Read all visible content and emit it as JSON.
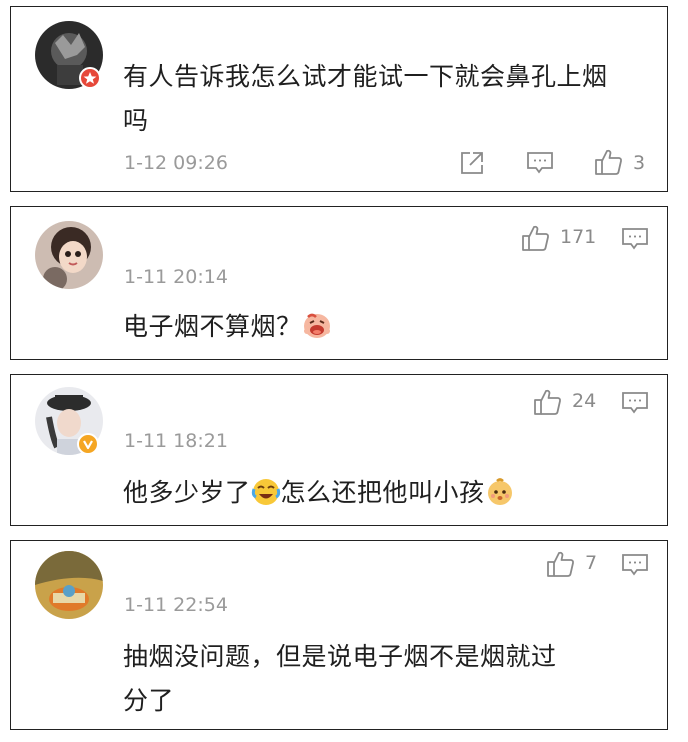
{
  "comments": [
    {
      "text": "有人告诉我怎么试才能试一下就会鼻孔上烟",
      "text_cont": "吗",
      "time": "1-12 09:26",
      "likes": "3",
      "badge": "red-star-badge"
    },
    {
      "text": "电子烟不算烟？",
      "emoji": "laughing-face-emoji",
      "time": "1-11 20:14",
      "likes": "171"
    },
    {
      "text_a": "他多少岁了",
      "emoji_a": "crying-laughing-emoji",
      "text_b": "怎么还把他叫小孩",
      "emoji_b": "baby-face-emoji",
      "time": "1-11 18:21",
      "likes": "24",
      "badge": "yellow-verified-badge"
    },
    {
      "text": "抽烟没问题，但是说电子烟不是烟就过",
      "text_cont": "分了",
      "time": "1-11 22:54",
      "likes": "7"
    }
  ],
  "colors": {
    "icon_gray": "#8a8a8a",
    "time_gray": "#9a9a9a",
    "border": "#222222"
  },
  "icons": [
    "share-icon",
    "comment-icon",
    "thumbs-up-icon"
  ]
}
